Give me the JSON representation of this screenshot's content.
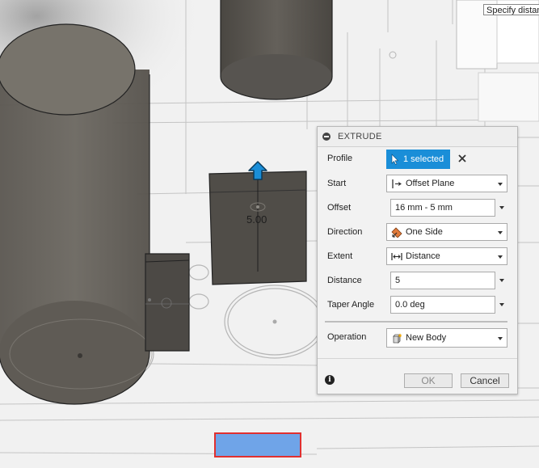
{
  "tooltip": "Specify distan",
  "viewport": {
    "dimension_label": "5.00"
  },
  "panel": {
    "title": "EXTRUDE",
    "profile": {
      "label": "Profile",
      "value": "1 selected"
    },
    "start": {
      "label": "Start",
      "value": "Offset Plane",
      "icon": "offset-plane-icon"
    },
    "offset": {
      "label": "Offset",
      "value": "16 mm - 5 mm"
    },
    "direction": {
      "label": "Direction",
      "value": "One Side",
      "icon": "one-side-icon"
    },
    "extent": {
      "label": "Extent",
      "value": "Distance",
      "icon": "distance-icon"
    },
    "distance": {
      "label": "Distance",
      "value": "5"
    },
    "taper_angle": {
      "label": "Taper Angle",
      "value": "0.0 deg"
    },
    "operation": {
      "label": "Operation",
      "value": "New Body",
      "icon": "new-body-icon"
    },
    "ok_label": "OK",
    "cancel_label": "Cancel"
  },
  "colors": {
    "accent": "#1a8ed8",
    "body_fill": "#5b5751",
    "sketch_fill": "#6fa4e8",
    "sketch_outline": "#e03030"
  }
}
